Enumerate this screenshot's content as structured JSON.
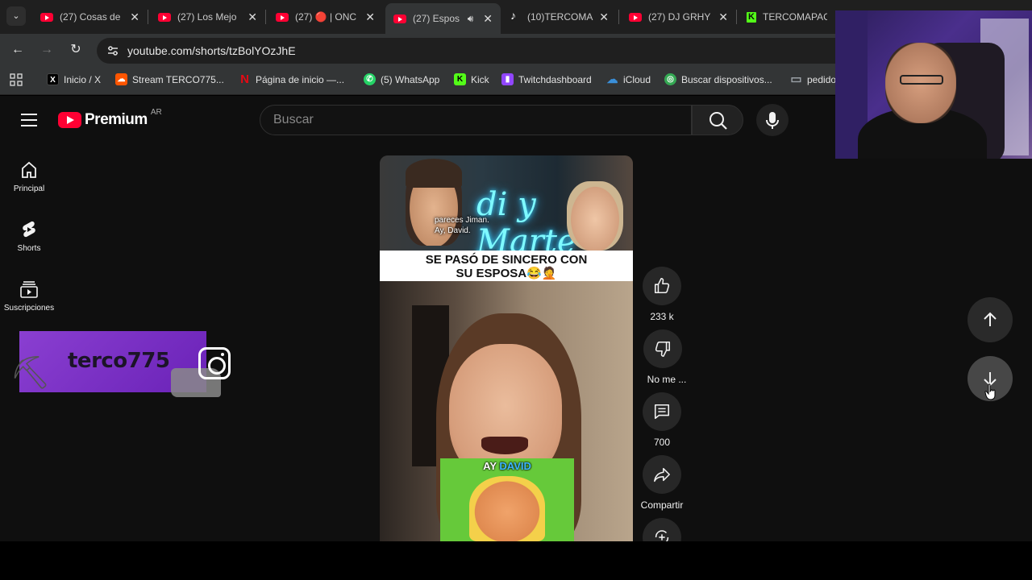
{
  "browser": {
    "tabs": [
      {
        "title": "(27) Cosas de",
        "icon": "youtube-icon",
        "active": false
      },
      {
        "title": "(27) Los Mejo",
        "icon": "youtube-icon",
        "active": false
      },
      {
        "title": "(27) 🔴 | ONC",
        "icon": "youtube-icon",
        "active": false
      },
      {
        "title": "(27) Espos",
        "icon": "youtube-icon",
        "active": true,
        "audio": true
      },
      {
        "title": "(10)TERCOMA",
        "icon": "tiktok-icon",
        "active": false
      },
      {
        "title": "(27) DJ GRHY",
        "icon": "youtube-icon",
        "active": false
      },
      {
        "title": "TERCOMAPAC",
        "icon": "kick-icon",
        "active": false
      }
    ],
    "url": "youtube.com/shorts/tzBolYOzJhE",
    "bookmarks": [
      {
        "label": "Inicio / X",
        "icon": "x-icon",
        "color": "#000000"
      },
      {
        "label": "Stream TERCO775...",
        "icon": "soundcloud-icon",
        "color": "#ff5500"
      },
      {
        "label": "Página de inicio —...",
        "icon": "netflix-icon",
        "color": "#e50914"
      },
      {
        "label": "(5) WhatsApp",
        "icon": "whatsapp-icon",
        "color": "#25d366"
      },
      {
        "label": "Kick",
        "icon": "kick-icon",
        "color": "#53fc18"
      },
      {
        "label": "Twitchdashboard",
        "icon": "twitch-icon",
        "color": "#9146ff"
      },
      {
        "label": "iCloud",
        "icon": "icloud-icon",
        "color": "#3a8fd9"
      },
      {
        "label": "Buscar dispositivos...",
        "icon": "find-device-icon",
        "color": "#34a853"
      },
      {
        "label": "pedido",
        "icon": "folder-icon",
        "color": "#9aa0a6"
      }
    ]
  },
  "youtube": {
    "logo_text": "Premium",
    "country": "AR",
    "search_placeholder": "Buscar",
    "sidebar": [
      {
        "label": "Principal",
        "icon": "home-icon"
      },
      {
        "label": "Shorts",
        "icon": "shorts-icon"
      },
      {
        "label": "Suscripciones",
        "icon": "subscriptions-icon"
      }
    ],
    "overlay_text": "terco775",
    "short": {
      "subtitle_line1": "pareces Jiman.",
      "subtitle_line2": "Ay, David.",
      "neon_text": "di y Marte",
      "headline_line1": "SE PASÓ DE SINCERO CON",
      "headline_line2": "SU ESPOSA😂🤦",
      "meme_white": "AY",
      "meme_blue": "DAVID"
    },
    "actions": {
      "likes": "233 k",
      "dislike_label": "No me ...",
      "comments": "700",
      "share_label": "Compartir"
    }
  },
  "colors": {
    "youtube_red": "#ff0033",
    "page_bg": "#0f0f0f",
    "chrome_bg": "#333536"
  }
}
